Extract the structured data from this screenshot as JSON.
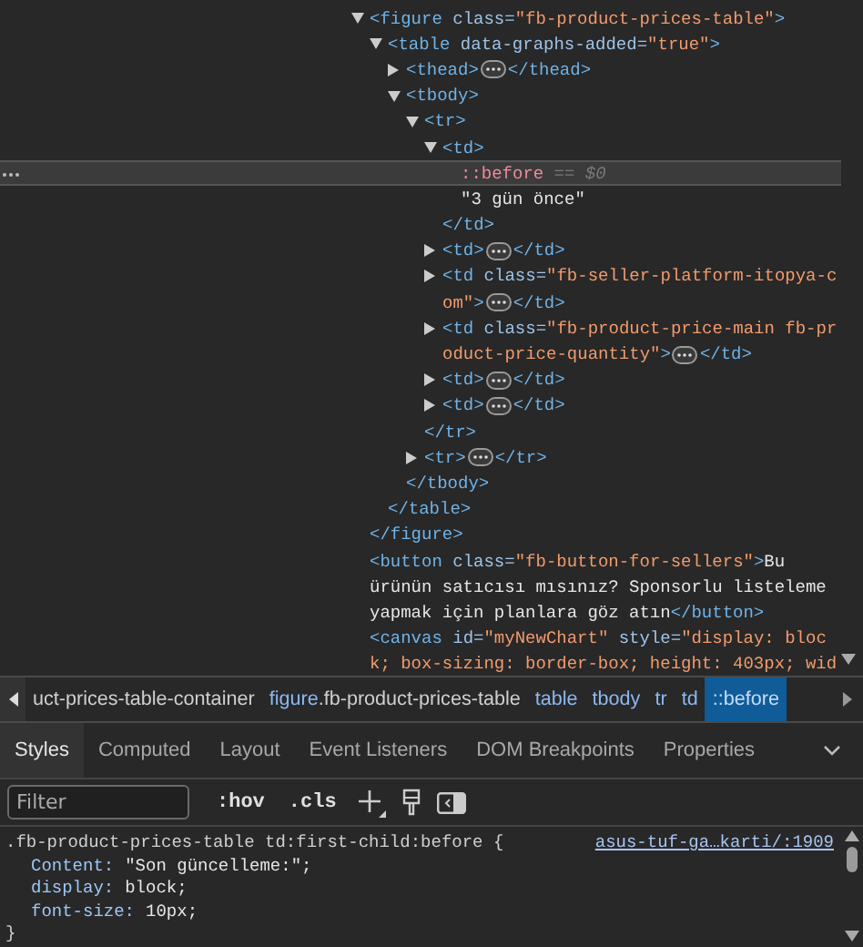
{
  "dom_tree": [
    {
      "expanded": true,
      "selected": false,
      "lines": [
        [
          {
            "kind": "tag",
            "text": "<figure"
          },
          {
            "kind": "attr",
            "text": " class="
          },
          {
            "kind": "value",
            "text": "\"fb-product-prices-table\""
          },
          {
            "kind": "tag",
            "text": ">"
          }
        ]
      ],
      "close": [
        {
          "kind": "tag",
          "text": "</figure>"
        }
      ],
      "children": [
        {
          "expanded": true,
          "selected": false,
          "lines": [
            [
              {
                "kind": "tag",
                "text": "<table"
              },
              {
                "kind": "attr",
                "text": " data-graphs-added="
              },
              {
                "kind": "value",
                "text": "\"true\""
              },
              {
                "kind": "tag",
                "text": ">"
              }
            ]
          ],
          "close": [
            {
              "kind": "tag",
              "text": "</table>"
            }
          ],
          "children": [
            {
              "expanded": false,
              "selected": false,
              "lines": [
                [
                  {
                    "kind": "tag",
                    "text": "<thead>"
                  },
                  {
                    "kind": "more"
                  },
                  {
                    "kind": "tag",
                    "text": "</thead>"
                  }
                ]
              ]
            },
            {
              "expanded": true,
              "selected": false,
              "lines": [
                [
                  {
                    "kind": "tag",
                    "text": "<tbody>"
                  }
                ]
              ],
              "close": [
                {
                  "kind": "tag",
                  "text": "</tbody>"
                }
              ],
              "children": [
                {
                  "expanded": true,
                  "selected": false,
                  "lines": [
                    [
                      {
                        "kind": "tag",
                        "text": "<tr>"
                      }
                    ]
                  ],
                  "close": [
                    {
                      "kind": "tag",
                      "text": "</tr>"
                    }
                  ],
                  "children": [
                    {
                      "expanded": true,
                      "selected": false,
                      "lines": [
                        [
                          {
                            "kind": "tag",
                            "text": "<td>"
                          }
                        ]
                      ],
                      "close": [
                        {
                          "kind": "tag",
                          "text": "</td>"
                        }
                      ],
                      "children": [
                        {
                          "selected": true,
                          "lines": [
                            [
                              {
                                "kind": "pseudo",
                                "text": "::before"
                              },
                              {
                                "kind": "dim",
                                "text": " == $0"
                              }
                            ]
                          ]
                        },
                        {
                          "selected": false,
                          "lines": [
                            [
                              {
                                "kind": "text",
                                "text": "\"3 gün önce\""
                              }
                            ]
                          ]
                        }
                      ]
                    },
                    {
                      "expanded": false,
                      "selected": false,
                      "lines": [
                        [
                          {
                            "kind": "tag",
                            "text": "<td>"
                          },
                          {
                            "kind": "more"
                          },
                          {
                            "kind": "tag",
                            "text": "</td>"
                          }
                        ]
                      ]
                    },
                    {
                      "expanded": false,
                      "selected": false,
                      "lines": [
                        [
                          {
                            "kind": "tag",
                            "text": "<td"
                          },
                          {
                            "kind": "attr",
                            "text": " class="
                          },
                          {
                            "kind": "value",
                            "text": "\"fb-seller-platform-itopya-c"
                          }
                        ],
                        [
                          {
                            "kind": "value",
                            "text": "om\""
                          },
                          {
                            "kind": "tag",
                            "text": ">"
                          },
                          {
                            "kind": "more"
                          },
                          {
                            "kind": "tag",
                            "text": "</td>"
                          }
                        ]
                      ]
                    },
                    {
                      "expanded": false,
                      "selected": false,
                      "lines": [
                        [
                          {
                            "kind": "tag",
                            "text": "<td"
                          },
                          {
                            "kind": "attr",
                            "text": " class="
                          },
                          {
                            "kind": "value",
                            "text": "\"fb-product-price-main fb-pr"
                          }
                        ],
                        [
                          {
                            "kind": "value",
                            "text": "oduct-price-quantity\""
                          },
                          {
                            "kind": "tag",
                            "text": ">"
                          },
                          {
                            "kind": "more"
                          },
                          {
                            "kind": "tag",
                            "text": "</td>"
                          }
                        ]
                      ]
                    },
                    {
                      "expanded": false,
                      "selected": false,
                      "lines": [
                        [
                          {
                            "kind": "tag",
                            "text": "<td>"
                          },
                          {
                            "kind": "more"
                          },
                          {
                            "kind": "tag",
                            "text": "</td>"
                          }
                        ]
                      ]
                    },
                    {
                      "expanded": false,
                      "selected": false,
                      "lines": [
                        [
                          {
                            "kind": "tag",
                            "text": "<td>"
                          },
                          {
                            "kind": "more"
                          },
                          {
                            "kind": "tag",
                            "text": "</td>"
                          }
                        ]
                      ]
                    }
                  ]
                },
                {
                  "expanded": false,
                  "selected": false,
                  "lines": [
                    [
                      {
                        "kind": "tag",
                        "text": "<tr>"
                      },
                      {
                        "kind": "more"
                      },
                      {
                        "kind": "tag",
                        "text": "</tr>"
                      }
                    ]
                  ]
                }
              ]
            }
          ]
        }
      ]
    },
    {
      "selected": false,
      "lines": [
        [
          {
            "kind": "tag",
            "text": "<button"
          },
          {
            "kind": "attr",
            "text": " class="
          },
          {
            "kind": "value",
            "text": "\"fb-button-for-sellers\""
          },
          {
            "kind": "tag",
            "text": ">"
          },
          {
            "kind": "text",
            "text": "Bu"
          }
        ],
        [
          {
            "kind": "text",
            "text": "ürünün satıcısı mısınız? Sponsorlu listeleme"
          }
        ],
        [
          {
            "kind": "text",
            "text": "yapmak için planlara göz atın"
          },
          {
            "kind": "tag",
            "text": "</button>"
          }
        ]
      ]
    },
    {
      "selected": false,
      "lines": [
        [
          {
            "kind": "tag",
            "text": "<canvas"
          },
          {
            "kind": "attr",
            "text": " id="
          },
          {
            "kind": "value",
            "text": "\"myNewChart\""
          },
          {
            "kind": "attr",
            "text": " style="
          },
          {
            "kind": "value",
            "text": "\"display: bloc"
          }
        ],
        [
          {
            "kind": "value",
            "text": "k; box-sizing: border-box; height: 403px; wid"
          }
        ]
      ]
    }
  ],
  "breadcrumbs": [
    {
      "cls": "uct-prices-table-container",
      "selected": false
    },
    {
      "tag": "figure",
      "cls": ".fb-product-prices-table",
      "selected": false
    },
    {
      "tag": "table",
      "selected": false
    },
    {
      "tag": "tbody",
      "selected": false
    },
    {
      "tag": "tr",
      "selected": false
    },
    {
      "tag": "td",
      "selected": false
    },
    {
      "tag": "::before",
      "selected": true
    }
  ],
  "tabs": [
    {
      "label": "Styles",
      "selected": true
    },
    {
      "label": "Computed",
      "selected": false
    },
    {
      "label": "Layout",
      "selected": false
    },
    {
      "label": "Event Listeners",
      "selected": false
    },
    {
      "label": "DOM Breakpoints",
      "selected": false
    },
    {
      "label": "Properties",
      "selected": false
    }
  ],
  "filter": {
    "placeholder": "Filter"
  },
  "toolbar_buttons": [
    ":hov",
    ".cls"
  ],
  "rule": {
    "selector": ".fb-product-prices-table td:first-child:before {",
    "source": "asus-tuf-ga…karti/:1909",
    "properties": [
      {
        "name": "Content:",
        "value": "\"Son güncelleme:\";"
      },
      {
        "name": "display:",
        "value": "block;"
      },
      {
        "name": "font-size:",
        "value": "10px;"
      }
    ],
    "close": "}"
  }
}
